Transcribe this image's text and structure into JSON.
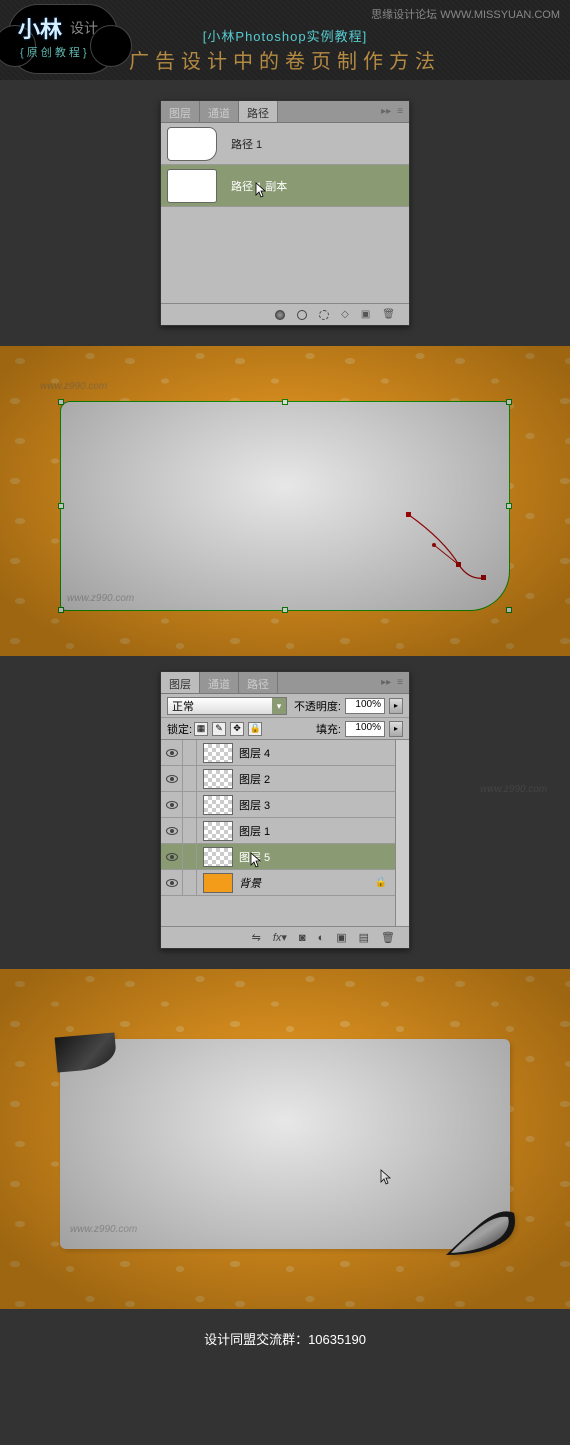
{
  "header": {
    "logo_main": "小林",
    "logo_sub": "设计",
    "logo_tag": "{ 原 创 教 程 }",
    "top_right": "思缘设计论坛  WWW.MISSYUAN.COM",
    "title_line1": "[小林Photoshop实例教程]",
    "title_line2": "广告设计中的卷页制作方法"
  },
  "paths_panel": {
    "tabs": [
      "图层",
      "通道",
      "路径"
    ],
    "rows": [
      {
        "label": "路径 1"
      },
      {
        "label": "路径 1 副本"
      }
    ]
  },
  "layers_panel": {
    "tabs": [
      "图层",
      "通道",
      "路径"
    ],
    "blend_mode": "正常",
    "opacity_label": "不透明度:",
    "opacity_value": "100%",
    "lock_label": "锁定:",
    "fill_label": "填充:",
    "fill_value": "100%",
    "layers": [
      {
        "name": "图层 4"
      },
      {
        "name": "图层 2"
      },
      {
        "name": "图层 3"
      },
      {
        "name": "图层 1"
      },
      {
        "name": "图层 5"
      },
      {
        "name": "背景"
      }
    ]
  },
  "watermarks": {
    "w1": "www.z990.com",
    "w2": "www.z990.com",
    "w3": "www.z990.com",
    "w4": "www.z990.com"
  },
  "footer": {
    "text": "设计同盟交流群：10635190"
  }
}
